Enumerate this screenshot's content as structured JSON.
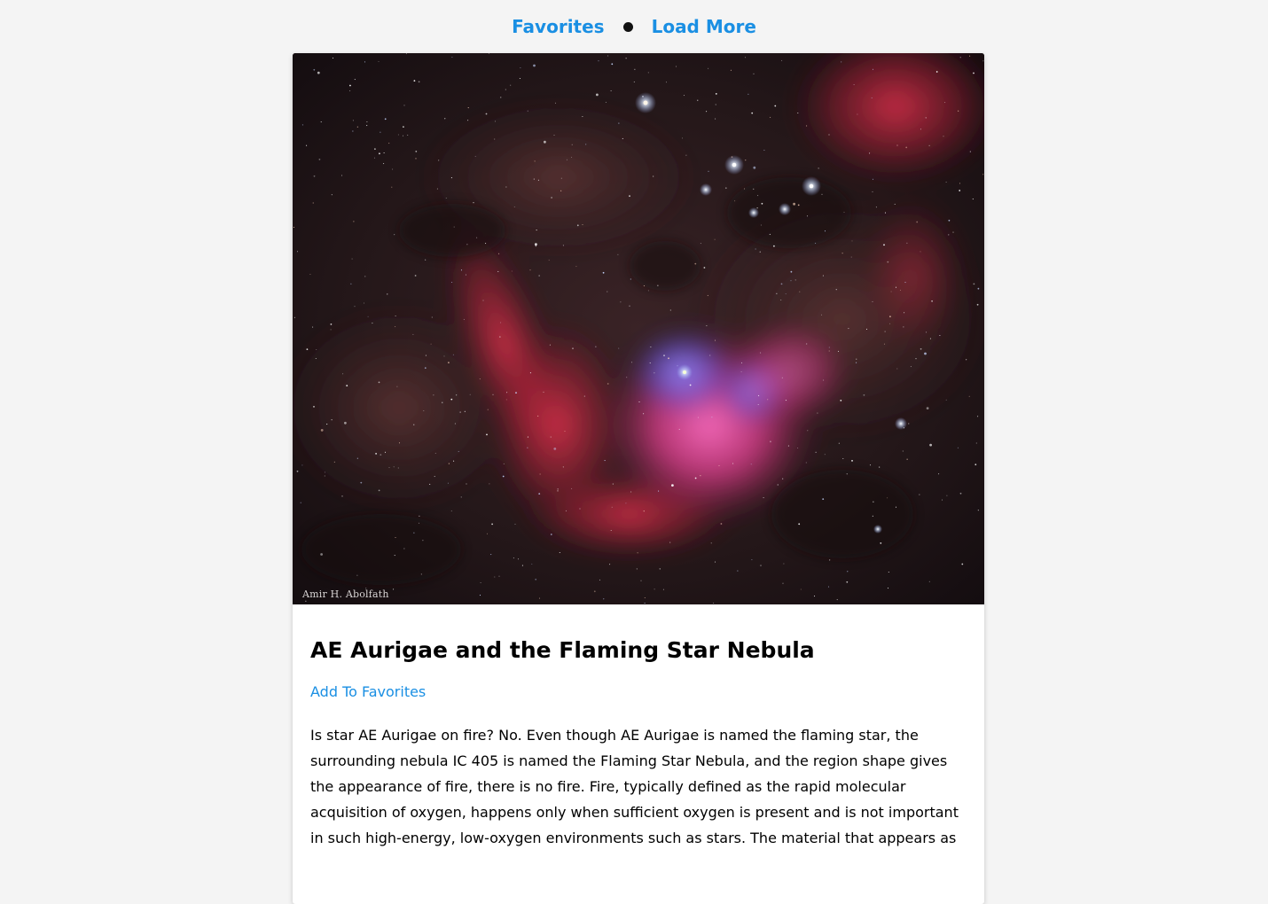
{
  "nav": {
    "favorites_label": "Favorites",
    "load_more_label": "Load More"
  },
  "apod": {
    "image_credit": "Amir H. Abolfath",
    "title": "AE Aurigae and the Flaming Star Nebula",
    "add_favorites_label": "Add To Favorites",
    "explanation": "Is star AE Aurigae on fire? No. Even though AE Aurigae is named the flaming star, the surrounding nebula IC 405 is named the Flaming Star Nebula, and the region shape gives the appearance of fire, there is no fire. Fire, typically defined as the rapid molecular acquisition of oxygen, happens only when sufficient oxygen is present and is not important in such high-energy, low-oxygen environments such as stars. The material that appears as"
  },
  "colors": {
    "link": "#1a8fe3",
    "background": "#f4f4f4",
    "card": "#ffffff"
  }
}
